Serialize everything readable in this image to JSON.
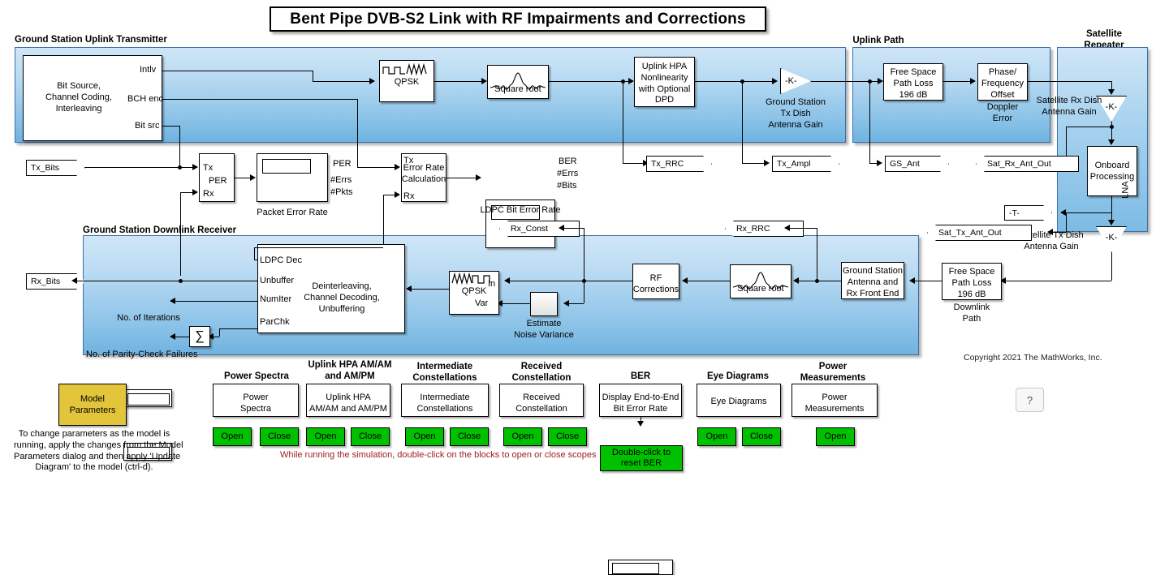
{
  "title": "Bent Pipe DVB-S2 Link with RF Impairments and Corrections",
  "copyright": "Copyright 2021 The MathWorks, Inc.",
  "panels": {
    "uplink_tx": "Ground Station Uplink Transmitter",
    "uplink_path": "Uplink Path",
    "satellite_repeater_line1": "Satellite",
    "satellite_repeater_line2": "Repeater",
    "downlink_rx": "Ground Station Downlink Receiver"
  },
  "blocks": {
    "bit_source": {
      "body_line1": "Bit Source,",
      "body_line2": "Channel Coding,",
      "body_line3": "Interleaving",
      "port_intlv": "Intlv",
      "port_bch": "BCH enc",
      "port_bitsrc": "Bit src"
    },
    "qpsk_tx": "QPSK",
    "sqrt_tx": "Square root",
    "uplink_hpa": {
      "l1": "Uplink HPA",
      "l2": "Nonlinearity",
      "l3": "with Optional",
      "l4": "DPD"
    },
    "gs_tx_gain": {
      "value": "-K-",
      "l1": "Ground Station",
      "l2": "Tx Dish",
      "l3": "Antenna Gain"
    },
    "fspl_up": {
      "l1": "Free Space",
      "l2": "Path Loss",
      "l3": "196 dB"
    },
    "phase_freq_offset": {
      "l1": "Phase/",
      "l2": "Frequency",
      "l3": "Offset",
      "cap1": "Doppler",
      "cap2": "Error"
    },
    "sat_rx_gain": {
      "value": "-K-",
      "l1": "Satellite Rx Dish",
      "l2": "Antenna Gain"
    },
    "onboard": {
      "l1": "Onboard",
      "l2": "Processing",
      "rot": "LNA"
    },
    "sat_tx_gain": {
      "value": "-K-",
      "l1": "Satellite Tx Dish",
      "l2": "Antenna Gain"
    },
    "temp_tag": "-T-",
    "fspl_down": {
      "l1": "Free Space",
      "l2": "Path Loss",
      "l3": "196 dB",
      "cap1": "Downlink",
      "cap2": "Path"
    },
    "gs_antenna_rx": {
      "l1": "Ground Station",
      "l2": "Antenna and",
      "l3": "Rx Front End"
    },
    "sqrt_rx": "Square root",
    "rf_corrections": {
      "l1": "RF",
      "l2": "Corrections"
    },
    "estimate_noise": {
      "cap1": "Estimate",
      "cap2": "Noise Variance"
    },
    "qpsk_rx": {
      "name": "QPSK",
      "port_in": "In",
      "port_var": "Var"
    },
    "ldpc_dec": {
      "b1": "Deinterleaving,",
      "b2": "Channel Decoding,",
      "b3": "Unbuffering",
      "port_ldpc": "LDPC Dec",
      "port_unbuffer": "Unbuffer",
      "port_numiter": "NumIter",
      "port_parchk": "ParChk"
    },
    "num_iterations": "No. of Iterations",
    "parity_failures": "No. of Parity-Check Failures",
    "sum_block": "∑",
    "per_block": {
      "port_tx": "Tx",
      "port_per": "PER",
      "port_rx": "Rx"
    },
    "packet_error_rate": {
      "caption": "Packet Error Rate",
      "out1": "PER",
      "out2": "#Errs",
      "out3": "#Pkts"
    },
    "error_rate_calc": {
      "l1": "Error Rate",
      "l2": "Calculation",
      "port_tx": "Tx",
      "port_rx": "Rx"
    },
    "ldpc_ber": {
      "caption": "LDPC Bit Error Rate",
      "out1": "BER",
      "out2": "#Errs",
      "out3": "#Bits"
    }
  },
  "tags": {
    "tx_bits": "Tx_Bits",
    "rx_bits": "Rx_Bits",
    "tx_rrc": "Tx_RRC",
    "tx_ampl": "Tx_Ampl",
    "gs_ant": "GS_Ant",
    "sat_rx_ant_out": "Sat_Rx_Ant_Out",
    "sat_tx_ant_out": "Sat_Tx_Ant_Out",
    "rx_const": "Rx_Const",
    "rx_rrc": "Rx_RRC"
  },
  "model_params": {
    "button_l1": "Model",
    "button_l2": "Parameters",
    "note_l1": "To change parameters as the model is",
    "note_l2": "running, apply the changes from the Model",
    "note_l3": "Parameters dialog and then apply 'Update",
    "note_l4": "Diagram' to the model (ctrl-d)."
  },
  "scope_panel": {
    "running_note": "While running the simulation, double-click on the blocks to open or close scopes",
    "open_label": "Open",
    "close_label": "Close",
    "help_label": "?",
    "groups": [
      {
        "title": "Power Spectra",
        "block_l1": "Power",
        "block_l2": "Spectra",
        "has_close": true
      },
      {
        "title": "Uplink HPA AM/AM\nand AM/PM",
        "title_l1": "Uplink HPA AM/AM",
        "title_l2": "and AM/PM",
        "block_l1": "Uplink HPA",
        "block_l2": "AM/AM and AM/PM",
        "has_close": true
      },
      {
        "title_l1": "Intermediate",
        "title_l2": "Constellations",
        "block_l1": "Intermediate",
        "block_l2": "Constellations",
        "has_close": true
      },
      {
        "title_l1": "Received",
        "title_l2": "Constellation",
        "block_l1": "Received",
        "block_l2": "Constellation",
        "has_close": true
      },
      {
        "title_l1": "BER",
        "title_l2": "",
        "block_l1": "Display End-to-End",
        "block_l2": "Bit Error Rate",
        "reset_l1": "Double-click to",
        "reset_l2": "reset BER",
        "has_close": false
      },
      {
        "title_l1": "Eye Diagrams",
        "title_l2": "",
        "block_l1": "Eye Diagrams",
        "block_l2": "",
        "has_close": true
      },
      {
        "title_l1": "Power",
        "title_l2": "Measurements",
        "block_l1": "Power",
        "block_l2": "Measurements",
        "has_close": false
      }
    ]
  },
  "colors": {
    "green_button": "#00c000",
    "yellow_button": "#e3c53c",
    "panel_blue_light": "#cfe6f7",
    "panel_blue_dark": "#6fb3e0",
    "note_red": "#a02020"
  }
}
